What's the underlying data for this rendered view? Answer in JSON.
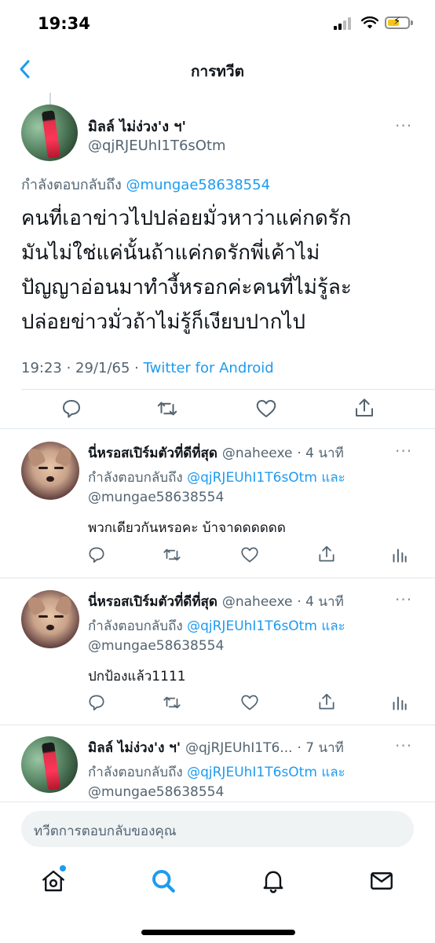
{
  "status_bar": {
    "time": "19:34"
  },
  "header": {
    "title": "การทวีต"
  },
  "main_tweet": {
    "name": "มิลล์ ไม่ง่วง'ง ฯ'",
    "handle": "@qjRJEUhI1T6sOtm",
    "replying_prefix": "กำลังตอบกลับถึง",
    "replying_to": "@mungae58638554",
    "text_lines": [
      "คนที่เอาข่าวไปปล่อยมั่วหาว่าแค่กดรัก",
      "มันไม่ใช่แค่นั้นถ้าแค่กดรักพี่เค้าไม่",
      "ปัญญาอ่อนมาทำงี้หรอกค่ะคนที่ไม่รู้ละ",
      "ปล่อยข่าวมั่วถ้าไม่รู้ก็เงียบปากไป"
    ],
    "time": "19:23 · 29/1/65 · ",
    "source": "Twitter for Android"
  },
  "replies": [
    {
      "name": "นี่หรอสเปิร์มตัวที่ดีที่สุด",
      "handle": "@naheexe",
      "age": "· 4 นาที",
      "replying_prefix": "กำลังตอบกลับถึง",
      "replying_to_1": "@qjRJEUhI1T6sOtm",
      "and": "และ",
      "replying_to_2": "@mungae58638554",
      "text": "พวกเดียวกันหรอคะ บ้าจาดดดดดด"
    },
    {
      "name": "นี่หรอสเปิร์มตัวที่ดีที่สุด",
      "handle": "@naheexe",
      "age": "· 4 นาที",
      "replying_prefix": "กำลังตอบกลับถึง",
      "replying_to_1": "@qjRJEUhI1T6sOtm",
      "and": "และ",
      "replying_to_2": "@mungae58638554",
      "text": "ปกป้องแล้ว1111"
    },
    {
      "name": "มิลล์ ไม่ง่วง'ง ฯ'",
      "handle": "@qjRJEUhI1T6...",
      "age": "· 7 นาที",
      "replying_prefix": "กำลังตอบกลับถึง",
      "replying_to_1": "@qjRJEUhI1T6sOtm",
      "and": "และ",
      "replying_to_2": "@mungae58638554"
    }
  ],
  "composer": {
    "placeholder": "ทวีตการตอบกลับของคุณ"
  },
  "more_label": "···",
  "colors": {
    "accent": "#1d9bf0",
    "muted": "#536471"
  },
  "icons": [
    "back-chevron-icon",
    "reply-icon",
    "retweet-icon",
    "like-icon",
    "share-icon",
    "analytics-icon",
    "home-icon",
    "search-icon",
    "notifications-icon",
    "messages-icon"
  ]
}
